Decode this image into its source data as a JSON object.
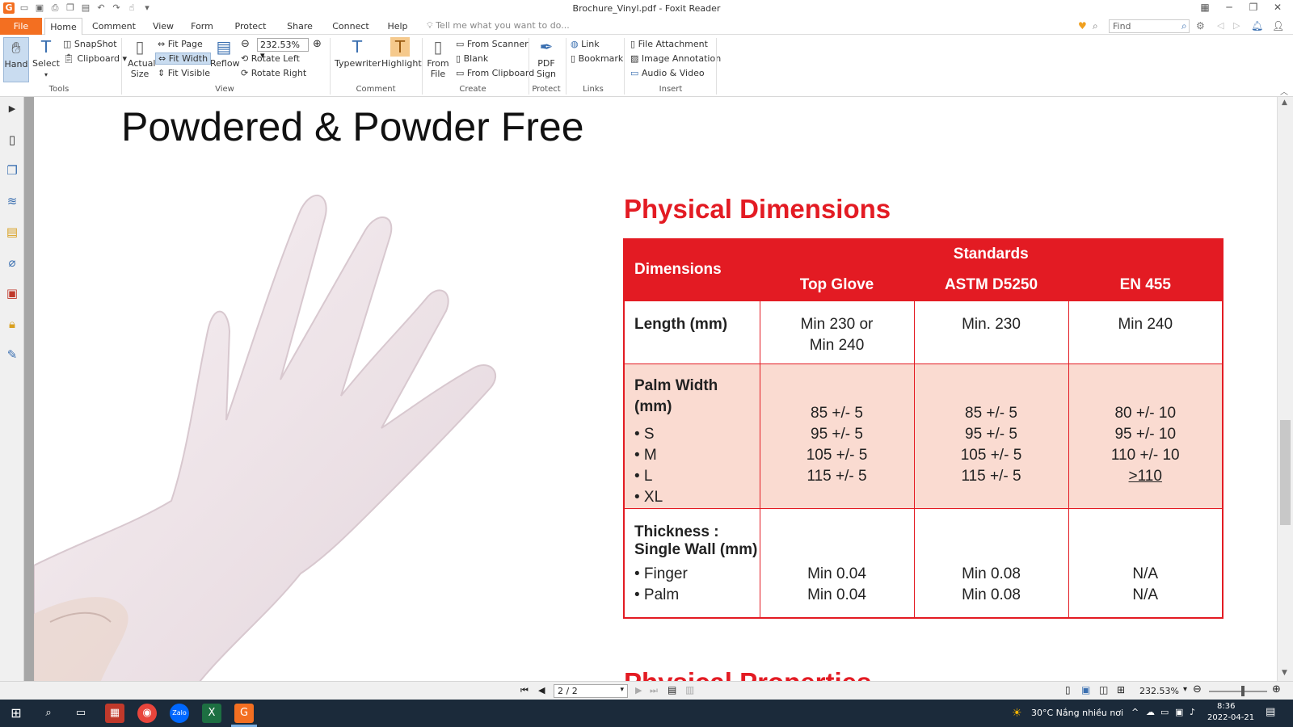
{
  "window": {
    "title": "Brochure_Vinyl.pdf - Foxit Reader"
  },
  "menu": {
    "tabs": [
      "File",
      "Home",
      "Comment",
      "View",
      "Form",
      "Protect",
      "Share",
      "Connect",
      "Help"
    ],
    "tell_me": "Tell me what you want to do...",
    "find_placeholder": "Find"
  },
  "ribbon": {
    "tools": {
      "label": "Tools",
      "hand": "Hand",
      "select": "Select",
      "snapshot": "SnapShot",
      "clipboard": "Clipboard"
    },
    "view": {
      "label": "View",
      "actual_size": "Actual Size",
      "fit_page": "Fit Page",
      "fit_width": "Fit Width",
      "fit_visible": "Fit Visible",
      "reflow": "Reflow",
      "zoom": "232.53%",
      "rotate_left": "Rotate Left",
      "rotate_right": "Rotate Right"
    },
    "comment": {
      "label": "Comment",
      "typewriter": "Typewriter",
      "highlight": "Highlight"
    },
    "create": {
      "label": "Create",
      "from_file": "From File",
      "from_scanner": "From Scanner",
      "blank": "Blank",
      "from_clipboard": "From Clipboard"
    },
    "protect": {
      "label": "Protect",
      "pdf_sign": "PDF Sign"
    },
    "links": {
      "label": "Links",
      "link": "Link",
      "bookmark": "Bookmark"
    },
    "insert": {
      "label": "Insert",
      "file_attachment": "File Attachment",
      "image_annotation": "Image Annotation",
      "audio_video": "Audio & Video"
    }
  },
  "document": {
    "heading": "Powdered & Powder Free",
    "section_title": "Physical Dimensions",
    "table": {
      "dimensions_header": "Dimensions",
      "standards_header": "Standards",
      "columns": [
        "Top Glove",
        "ASTM D5250",
        "EN 455"
      ],
      "length": {
        "label": "Length (mm)",
        "values": [
          "Min 230 or",
          "Min 240",
          "Min. 230",
          "Min 240"
        ]
      },
      "palm": {
        "label": "Palm Width (mm)",
        "sizes": [
          "• S",
          "• M",
          "• L",
          "• XL"
        ],
        "top_glove": [
          "85 +/- 5",
          "95 +/- 5",
          "105 +/- 5",
          "115 +/- 5"
        ],
        "astm": [
          "85 +/- 5",
          "95 +/- 5",
          "105 +/- 5",
          "115 +/- 5"
        ],
        "en455": [
          "80 +/- 10",
          "95 +/- 10",
          "110 +/- 10",
          ">110"
        ]
      },
      "thickness": {
        "label1": "Thickness :",
        "label2": "Single Wall (mm)",
        "parts": [
          "• Finger",
          "• Palm"
        ],
        "top_glove": [
          "Min 0.04",
          "Min 0.04"
        ],
        "astm": [
          "Min 0.08",
          "Min 0.08"
        ],
        "en455": [
          "N/A",
          "N/A"
        ]
      }
    },
    "next_section_partial": "Physical Properties"
  },
  "status": {
    "page": "2 / 2",
    "zoom": "232.53%"
  },
  "taskbar": {
    "weather": "30°C  Nắng nhiều nơi",
    "time": "8:36",
    "date": "2022-04-21"
  },
  "colors": {
    "accent": "#e31b23",
    "foxit_orange": "#f36f21",
    "pink_row": "#fadbd1"
  }
}
